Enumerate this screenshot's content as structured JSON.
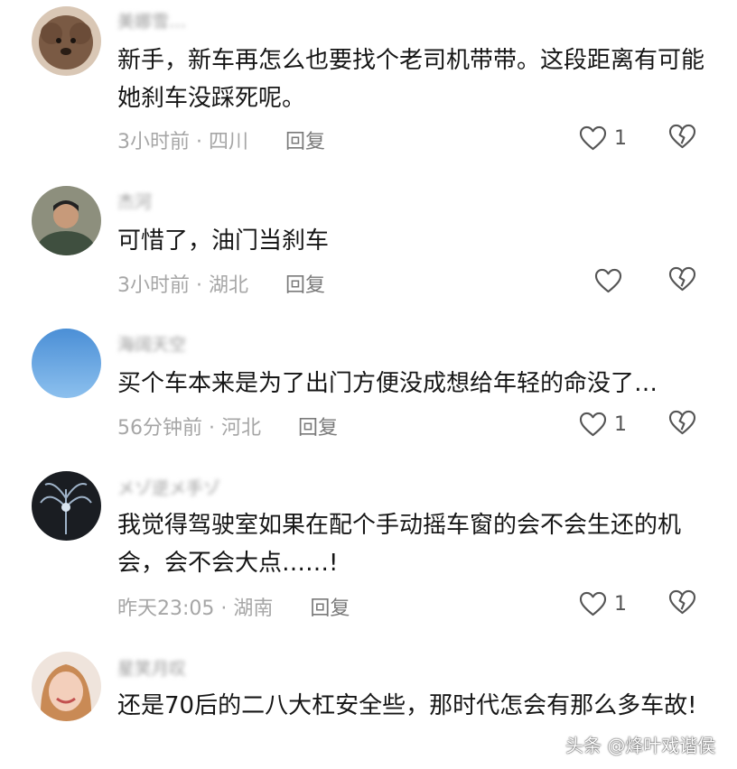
{
  "comments": [
    {
      "username": "美娜雪…",
      "text": "新手，新车再怎么也要找个老司机带带。这段距离有可能她刹车没踩死呢。",
      "time": "3小时前",
      "location": "四川",
      "reply_label": "回复",
      "like_count": "1",
      "avatar_color": "#6b5342"
    },
    {
      "username": "杰河",
      "text": "可惜了，油门当刹车",
      "time": "3小时前",
      "location": "湖北",
      "reply_label": "回复",
      "like_count": "",
      "avatar_color": "#3f4f3f"
    },
    {
      "username": "海阔天空",
      "text": "买个车本来是为了出门方便没成想给年轻的命没了…",
      "time": "56分钟前",
      "location": "河北",
      "reply_label": "回复",
      "like_count": "1",
      "avatar_color": "#5f9fdc"
    },
    {
      "username": "メゾ逆メ手ゾ",
      "text": "我觉得驾驶室如果在配个手动摇车窗的会不会生还的机会，会不会大点……!",
      "time": "昨天23:05",
      "location": "湖南",
      "reply_label": "回复",
      "like_count": "1",
      "avatar_color": "#1f2328"
    },
    {
      "username": "星笑月叹",
      "text": "还是70后的二八大杠安全些，那时代怎会有那么多车故!",
      "time": "",
      "location": "",
      "reply_label": "",
      "like_count": "",
      "avatar_color": "#e7b49a"
    }
  ],
  "separator": "·",
  "watermark": "头条 @烽叶戏谐侯"
}
